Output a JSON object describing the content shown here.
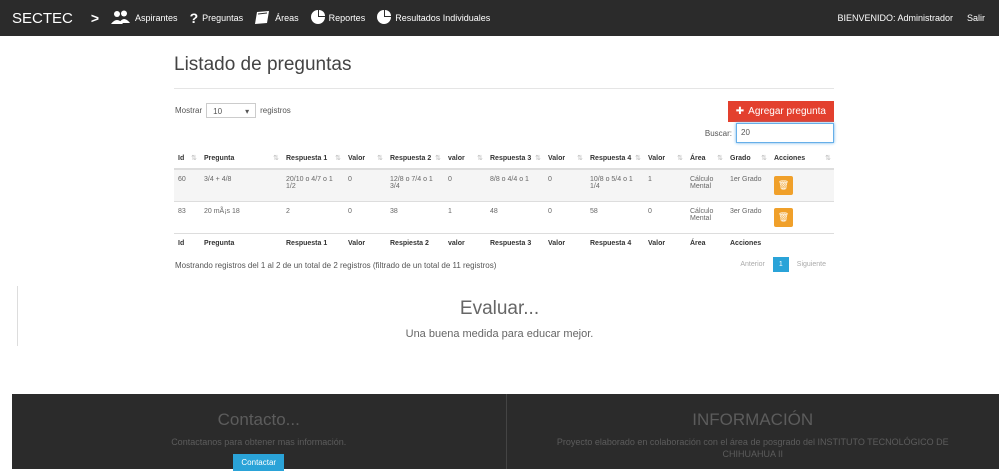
{
  "nav": {
    "brand": "SECTEC",
    "items": [
      {
        "label": "Aspirantes",
        "icon": "users-icon"
      },
      {
        "label": "Preguntas",
        "icon": "question-icon"
      },
      {
        "label": "Áreas",
        "icon": "book-icon"
      },
      {
        "label": "Reportes",
        "icon": "pie-chart-icon"
      },
      {
        "label": "Resultados Individuales",
        "icon": "pie-chart-icon"
      }
    ],
    "welcome": "BIENVENIDO: Administrador",
    "logout": "Salir"
  },
  "page": {
    "title": "Listado de preguntas",
    "show_label": "Mostrar",
    "show_value": "10",
    "records_label": "registros",
    "add_button": "Agregar pregunta",
    "search_label": "Buscar:",
    "search_value": "20"
  },
  "table": {
    "headers": [
      "Id",
      "Pregunta",
      "Respuesta 1",
      "Valor",
      "Respuesta 2",
      "valor",
      "Respuesta 3",
      "Valor",
      "Respuesta 4",
      "Valor",
      "Área",
      "Grado",
      "Acciones"
    ],
    "footer_headers": [
      "Id",
      "Pregunta",
      "Respuesta 1",
      "Valor",
      "Respiesta 2",
      "valor",
      "Respuesta 3",
      "Valor",
      "Respuesta 4",
      "Valor",
      "Área",
      "Acciones"
    ],
    "rows": [
      {
        "id": "60",
        "pregunta": "3/4 + 4/8",
        "r1": "20/10 o 4/7 o 1 1/2",
        "v1": "0",
        "r2": "12/8 o 7/4 o 1 3/4",
        "v2": "0",
        "r3": "8/8 o 4/4 o 1",
        "v3": "0",
        "r4": "10/8 o 5/4 o 1 1/4",
        "v4": "1",
        "area": "Cálculo Mental",
        "grado": "1er Grado"
      },
      {
        "id": "83",
        "pregunta": "20 mÃ¡s 18",
        "r1": "2",
        "v1": "0",
        "r2": "38",
        "v2": "1",
        "r3": "48",
        "v3": "0",
        "r4": "58",
        "v4": "0",
        "area": "Cálculo Mental",
        "grado": "3er Grado"
      }
    ],
    "info": "Mostrando registros del 1 al 2 de un total de 2 registros (filtrado de un total de 11 registros)",
    "prev": "Anterior",
    "page": "1",
    "next": "Siguiente"
  },
  "evaluar": {
    "title": "Evaluar...",
    "subtitle": "Una buena medida para educar mejor."
  },
  "footer": {
    "contact_title": "Contacto...",
    "contact_text": "Contactanos para obtener mas información.",
    "contact_button": "Contactar",
    "info_title": "INFORMACIÓN",
    "info_text": "Proyecto elaborado en colaboración con el área de posgrado del INSTITUTO TECNOLÓGICO DE CHIHUAHUA II"
  },
  "colors": {
    "navbar": "#2b2b2b",
    "add_button": "#e3402e",
    "delete_button": "#f0a02a",
    "accent": "#2aa3d8"
  }
}
